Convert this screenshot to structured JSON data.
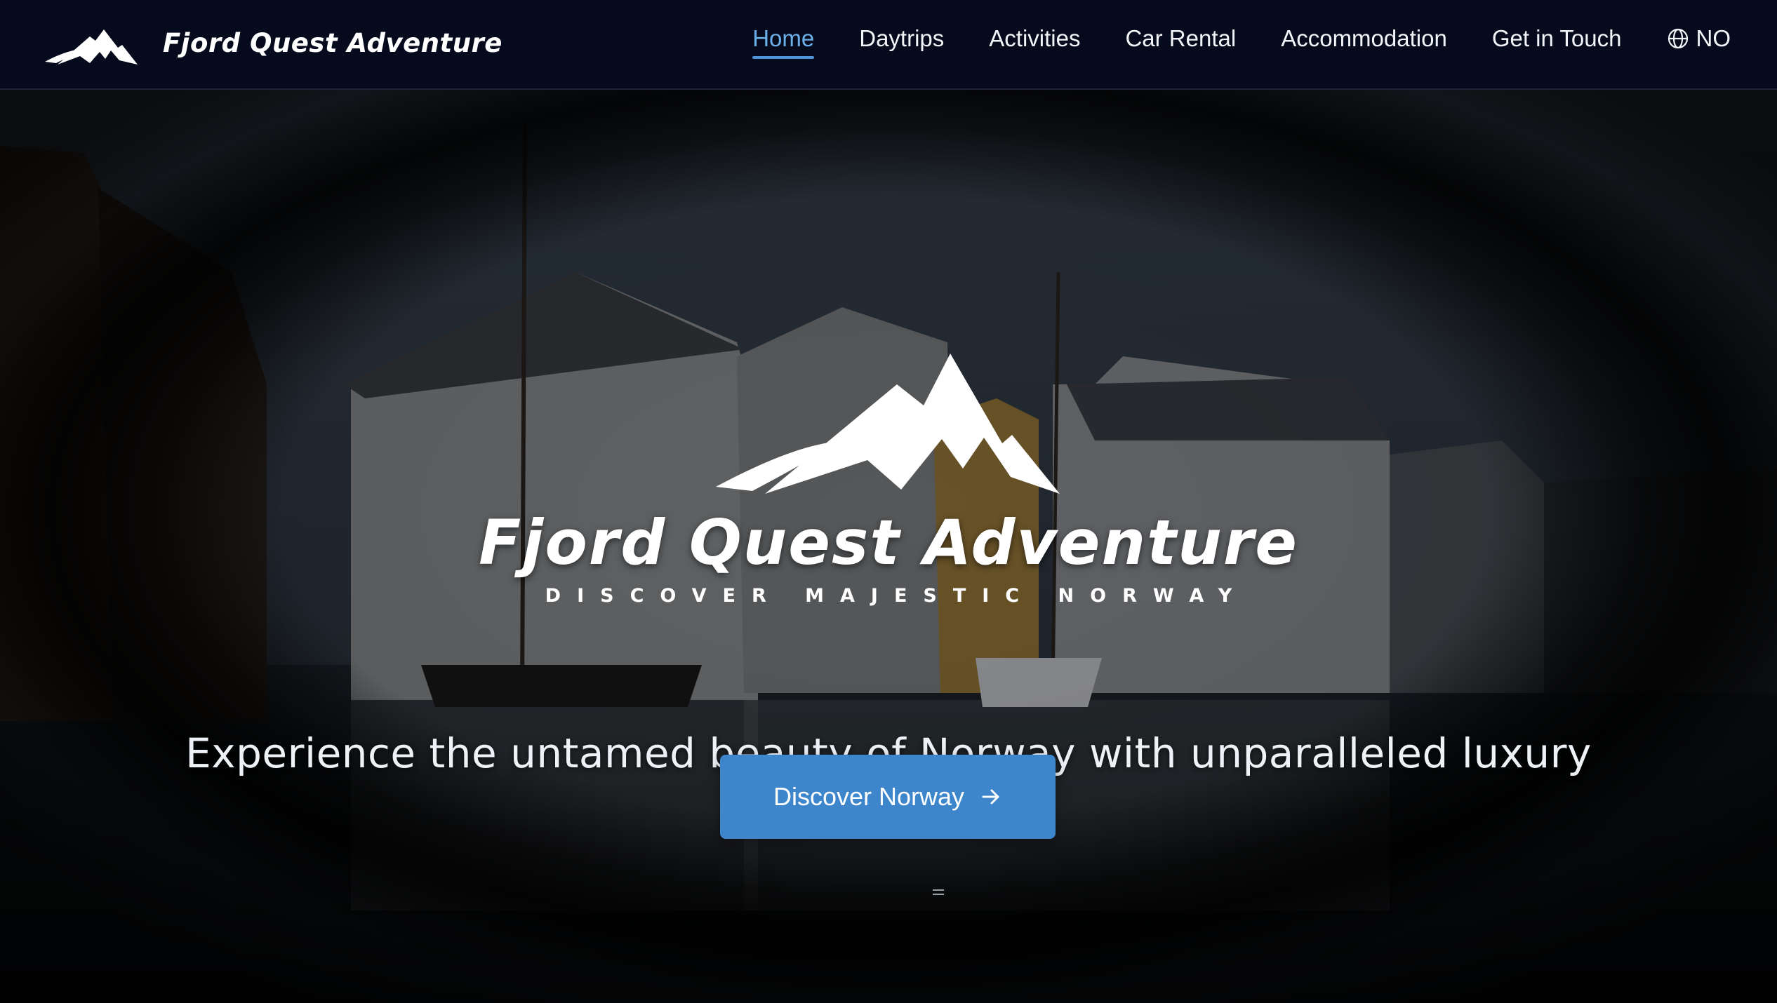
{
  "header": {
    "brand_name": "Fjord Quest Adventure",
    "brand_icon": "mountain-logo-icon",
    "nav": [
      {
        "label": "Home",
        "active": true
      },
      {
        "label": "Daytrips",
        "active": false
      },
      {
        "label": "Activities",
        "active": false
      },
      {
        "label": "Car Rental",
        "active": false
      },
      {
        "label": "Accommodation",
        "active": false
      },
      {
        "label": "Get in Touch",
        "active": false
      }
    ],
    "language": {
      "icon": "globe-icon",
      "label": "NO"
    }
  },
  "hero": {
    "logo_icon": "mountain-logo-icon",
    "title": "Fjord Quest Adventure",
    "tagline": "DISCOVER MAJESTIC NORWAY",
    "subtitle": "Experience the untamed beauty of Norway with unparalleled luxury",
    "cta_label": "Discover Norway",
    "cta_icon": "arrow-right-icon",
    "background": "dark harbour at dusk viewed through a circular frame"
  },
  "colors": {
    "header_bg": "#050a1c",
    "accent": "#3d86cb",
    "active_nav": "#6cb0ea",
    "text": "#ffffff"
  }
}
